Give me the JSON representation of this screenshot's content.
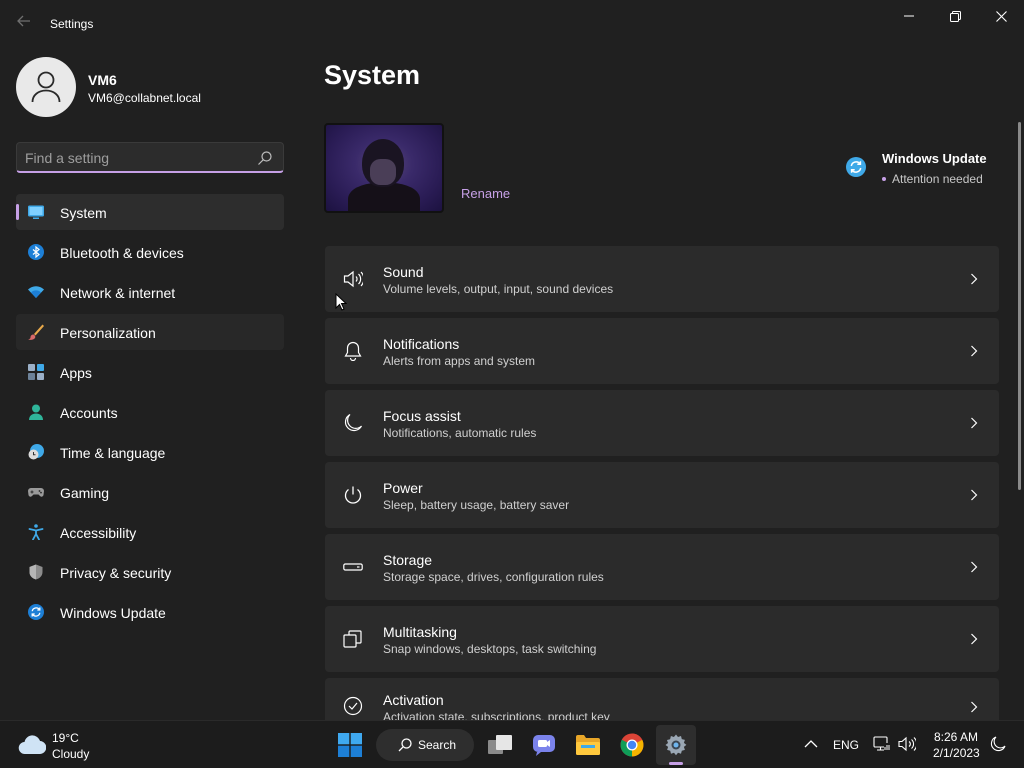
{
  "window": {
    "app_title": "Settings"
  },
  "profile": {
    "name": "VM6",
    "email": "VM6@collabnet.local"
  },
  "search": {
    "placeholder": "Find a setting"
  },
  "sidebar": {
    "items": [
      {
        "label": "System",
        "icon": "monitor-icon",
        "state": "active"
      },
      {
        "label": "Bluetooth & devices",
        "icon": "bluetooth-icon",
        "state": ""
      },
      {
        "label": "Network & internet",
        "icon": "wifi-icon",
        "state": ""
      },
      {
        "label": "Personalization",
        "icon": "brush-icon",
        "state": "hover"
      },
      {
        "label": "Apps",
        "icon": "apps-icon",
        "state": ""
      },
      {
        "label": "Accounts",
        "icon": "person-icon",
        "state": ""
      },
      {
        "label": "Time & language",
        "icon": "clock-globe-icon",
        "state": ""
      },
      {
        "label": "Gaming",
        "icon": "gamepad-icon",
        "state": ""
      },
      {
        "label": "Accessibility",
        "icon": "accessibility-icon",
        "state": ""
      },
      {
        "label": "Privacy & security",
        "icon": "shield-icon",
        "state": ""
      },
      {
        "label": "Windows Update",
        "icon": "update-icon",
        "state": ""
      }
    ]
  },
  "main": {
    "title": "System",
    "device": {
      "rename_label": "Rename"
    },
    "windows_update": {
      "title": "Windows Update",
      "status": "Attention needed"
    },
    "cards": [
      {
        "title": "Sound",
        "desc": "Volume levels, output, input, sound devices",
        "icon": "speaker-icon"
      },
      {
        "title": "Notifications",
        "desc": "Alerts from apps and system",
        "icon": "bell-icon"
      },
      {
        "title": "Focus assist",
        "desc": "Notifications, automatic rules",
        "icon": "moon-icon"
      },
      {
        "title": "Power",
        "desc": "Sleep, battery usage, battery saver",
        "icon": "power-icon"
      },
      {
        "title": "Storage",
        "desc": "Storage space, drives, configuration rules",
        "icon": "drive-icon"
      },
      {
        "title": "Multitasking",
        "desc": "Snap windows, desktops, task switching",
        "icon": "multitask-icon"
      },
      {
        "title": "Activation",
        "desc": "Activation state, subscriptions, product key",
        "icon": "check-circle-icon"
      }
    ]
  },
  "taskbar": {
    "weather": {
      "temp": "19°C",
      "desc": "Cloudy"
    },
    "search_label": "Search",
    "language": "ENG",
    "time": "8:26 AM",
    "date": "2/1/2023"
  },
  "colors": {
    "accent": "#c6a0e6",
    "background": "#202020",
    "card": "#2b2b2b"
  }
}
